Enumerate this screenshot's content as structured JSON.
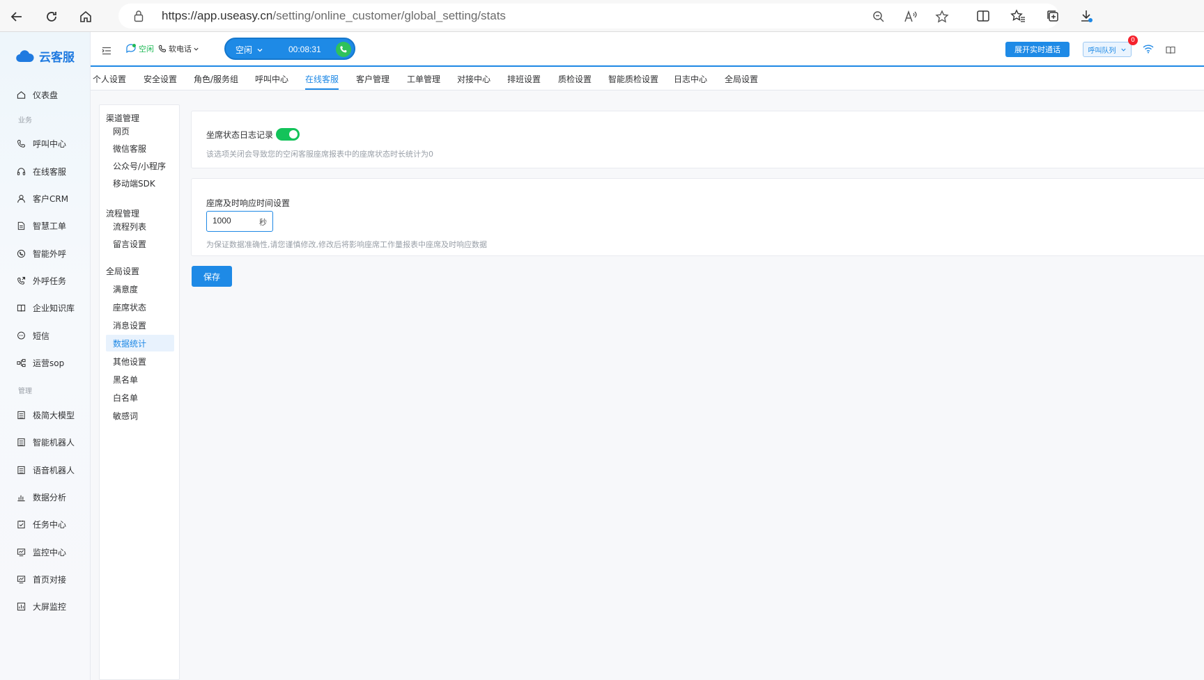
{
  "browser": {
    "url_host": "https://app.useasy.cn",
    "url_path": "/setting/online_customer/global_setting/stats"
  },
  "app": {
    "logo_text": "云客服"
  },
  "sidebar": {
    "dashboard": "仪表盘",
    "section_business": "业务",
    "business_items": [
      "呼叫中心",
      "在线客服",
      "客户CRM",
      "智慧工单",
      "智能外呼",
      "外呼任务",
      "企业知识库",
      "短信",
      "运营sop"
    ],
    "section_manage": "管理",
    "manage_items": [
      "极简大模型",
      "智能机器人",
      "语音机器人",
      "数据分析",
      "任务中心",
      "监控中心",
      "首页对接",
      "大屏监控"
    ]
  },
  "header": {
    "status_small": "空闲",
    "softphone": "软电话",
    "call_status": "空闲",
    "call_timer": "00:08:31",
    "realtime_button": "展开实时通话",
    "queue_label": "呼叫队列",
    "queue_badge": "0"
  },
  "tabs": [
    "个人设置",
    "安全设置",
    "角色/服务组",
    "呼叫中心",
    "在线客服",
    "客户管理",
    "工单管理",
    "对接中心",
    "排班设置",
    "质检设置",
    "智能质检设置",
    "日志中心",
    "全局设置"
  ],
  "active_tab": "在线客服",
  "submenu": {
    "groups": [
      {
        "title": "渠道管理",
        "items": [
          "网页",
          "微信客服",
          "公众号/小程序",
          "移动端SDK"
        ]
      },
      {
        "title": "流程管理",
        "items": [
          "流程列表",
          "留言设置"
        ]
      },
      {
        "title": "全局设置",
        "items": [
          "满意度",
          "座席状态",
          "消息设置",
          "数据统计",
          "其他设置",
          "黑名单",
          "白名单",
          "敏感词"
        ]
      }
    ],
    "active_item": "数据统计"
  },
  "content": {
    "log_title": "坐席状态日志记录",
    "log_enabled": true,
    "log_desc": "该选项关闭会导致您的空闲客服座席报表中的座席状态时长统计为0",
    "response_title": "座席及时响应时间设置",
    "response_value": "1000",
    "response_unit": "秒",
    "response_desc": "为保证数据准确性,请您谨慎修改,修改后将影响座席工作量报表中座席及时响应数据",
    "save_label": "保存"
  },
  "colors": {
    "primary": "#1e88e5",
    "toggle_on": "#13c35a",
    "badge": "#f5222d"
  }
}
